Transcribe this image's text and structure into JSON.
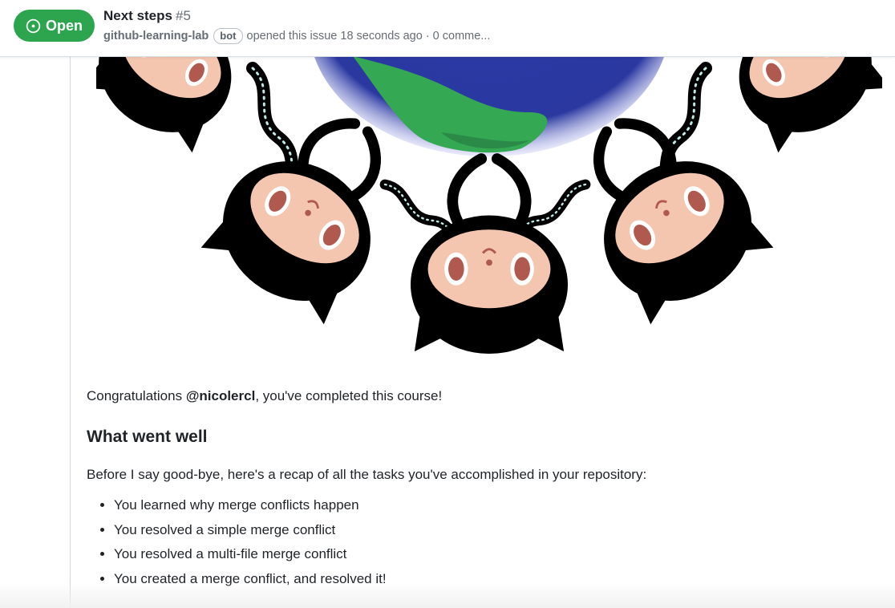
{
  "header": {
    "state_label": "Open",
    "title": "Next steps",
    "number": "#5",
    "author": "github-learning-lab",
    "author_badge": "bot",
    "opened_text": "opened this issue 18 seconds ago · 0 comme..."
  },
  "body": {
    "congrats_prefix": "Congratulations ",
    "mention": "@nicolercl",
    "congrats_suffix": ", you've completed this course!",
    "heading": "What went well",
    "recap_intro": "Before I say good-bye, here's a recap of all the tasks you've accomplished in your repository:",
    "tasks": [
      "You learned why merge conflicts happen",
      "You resolved a simple merge conflict",
      "You resolved a multi-file merge conflict",
      "You created a merge conflict, and resolved it!"
    ]
  },
  "colors": {
    "open_green": "#2da44e",
    "globe_blue": "#2c3aa8",
    "land_green": "#34a853",
    "octocat_black": "#000000",
    "face_skin": "#f4c6b0",
    "eye_red": "#b05a4f"
  },
  "icons": {
    "state": "issue-opened-icon"
  }
}
